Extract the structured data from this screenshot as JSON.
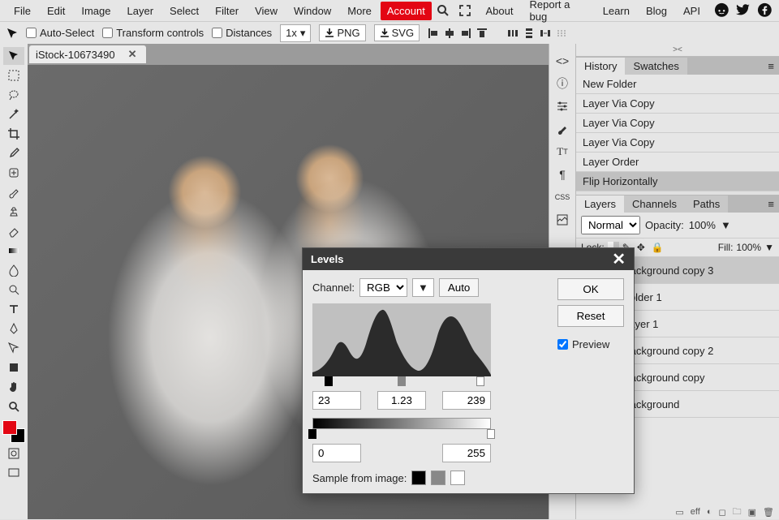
{
  "menu": {
    "items": [
      "File",
      "Edit",
      "Image",
      "Layer",
      "Select",
      "Filter",
      "View",
      "Window",
      "More"
    ],
    "account": "Account",
    "right": [
      "About",
      "Report a bug",
      "Learn",
      "Blog",
      "API"
    ]
  },
  "options": {
    "auto_select": "Auto-Select",
    "transform": "Transform controls",
    "distances": "Distances",
    "zoom": "1x",
    "png": "PNG",
    "svg": "SVG"
  },
  "tab": {
    "name": "iStock-10673490"
  },
  "history": {
    "panel_tabs": [
      "History",
      "Swatches"
    ],
    "items": [
      "New Folder",
      "Layer Via Copy",
      "Layer Via Copy",
      "Layer Via Copy",
      "Layer Order",
      "Flip Horizontally"
    ],
    "active": 5
  },
  "layers": {
    "panel_tabs": [
      "Layers",
      "Channels",
      "Paths"
    ],
    "blend": "Normal",
    "opacity_label": "Opacity:",
    "opacity": "100%",
    "lock_label": "Lock:",
    "fill_label": "Fill:",
    "fill": "100%",
    "items": [
      "Background copy 3",
      "Folder 1",
      "Layer 1",
      "Background copy 2",
      "Background copy",
      "Background"
    ],
    "selected": 0
  },
  "levels": {
    "title": "Levels",
    "channel_label": "Channel:",
    "channel": "RGB",
    "auto": "Auto",
    "ok": "OK",
    "reset": "Reset",
    "preview": "Preview",
    "in_black": "23",
    "in_gamma": "1.23",
    "in_white": "239",
    "out_black": "0",
    "out_white": "255",
    "sample_label": "Sample from image:"
  },
  "status": {
    "eff": "eff"
  }
}
